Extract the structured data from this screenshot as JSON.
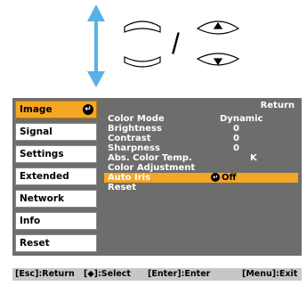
{
  "sidebar": {
    "items": [
      {
        "label": "Image",
        "active": true
      },
      {
        "label": "Signal",
        "active": false
      },
      {
        "label": "Settings",
        "active": false
      },
      {
        "label": "Extended",
        "active": false
      },
      {
        "label": "Network",
        "active": false
      },
      {
        "label": "Info",
        "active": false
      },
      {
        "label": "Reset",
        "active": false
      }
    ]
  },
  "menu": {
    "return_label": "Return",
    "rows": [
      {
        "label": "Color Mode",
        "value": "Dynamic"
      },
      {
        "label": "Brightness",
        "value": "0"
      },
      {
        "label": "Contrast",
        "value": "0"
      },
      {
        "label": "Sharpness",
        "value": "0"
      },
      {
        "label": "Abs. Color Temp.",
        "value": "K"
      },
      {
        "label": "Color Adjustment",
        "value": ""
      },
      {
        "label": "Auto Iris",
        "value": "Off",
        "selected": true
      },
      {
        "label": "Reset",
        "value": ""
      }
    ]
  },
  "footer": {
    "esc": "[Esc]:Return",
    "select": "[◆]:Select",
    "enter": "[Enter]:Enter",
    "menu": "[Menu]:Exit"
  },
  "colors": {
    "panel_bg": "#6d6d6d",
    "accent": "#f5a623",
    "footer_bg": "#c7c7c7"
  },
  "diagram": {
    "separator": "/"
  }
}
